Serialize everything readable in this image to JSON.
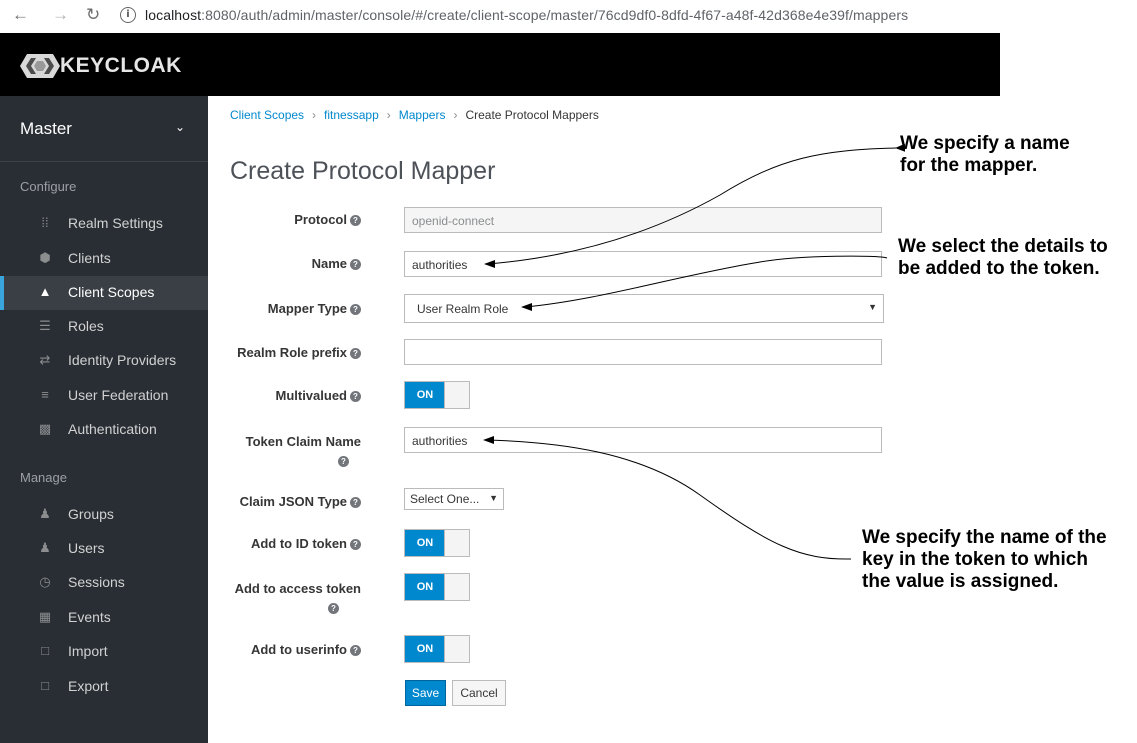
{
  "browser": {
    "url_host": "localhost",
    "url_rest": ":8080/auth/admin/master/console/#/create/client-scope/master/76cd9df0-8dfd-4f67-a48f-42d368e4e39f/mappers"
  },
  "header": {
    "logo_text": "KEYCLOAK"
  },
  "sidebar": {
    "realm": "Master",
    "configure_label": "Configure",
    "manage_label": "Manage",
    "configure_items": [
      {
        "label": "Realm Settings",
        "icon": "sliders-icon"
      },
      {
        "label": "Clients",
        "icon": "cube-icon"
      },
      {
        "label": "Client Scopes",
        "icon": "cubes-icon",
        "active": true
      },
      {
        "label": "Roles",
        "icon": "list-icon"
      },
      {
        "label": "Identity Providers",
        "icon": "exchange-icon"
      },
      {
        "label": "User Federation",
        "icon": "database-icon"
      },
      {
        "label": "Authentication",
        "icon": "lock-icon"
      }
    ],
    "manage_items": [
      {
        "label": "Groups",
        "icon": "users-icon"
      },
      {
        "label": "Users",
        "icon": "user-icon"
      },
      {
        "label": "Sessions",
        "icon": "clock-icon"
      },
      {
        "label": "Events",
        "icon": "calendar-icon"
      },
      {
        "label": "Import",
        "icon": "import-icon"
      },
      {
        "label": "Export",
        "icon": "export-icon"
      }
    ]
  },
  "breadcrumb": {
    "items": [
      "Client Scopes",
      "fitnessapp",
      "Mappers"
    ],
    "current": "Create Protocol Mappers"
  },
  "page_title": "Create Protocol Mapper",
  "form": {
    "protocol_label": "Protocol",
    "protocol_value": "openid-connect",
    "name_label": "Name",
    "name_value": "authorities",
    "mapper_type_label": "Mapper Type",
    "mapper_type_value": "User Realm Role",
    "realm_role_prefix_label": "Realm Role prefix",
    "realm_role_prefix_value": "",
    "multivalued_label": "Multivalued",
    "multivalued_state": "ON",
    "token_claim_name_label": "Token Claim Name",
    "token_claim_name_value": "authorities",
    "claim_json_type_label": "Claim JSON Type",
    "claim_json_type_value": "Select One...",
    "add_to_id_token_label": "Add to ID token",
    "add_to_id_token_state": "ON",
    "add_to_access_token_label": "Add to access token",
    "add_to_access_token_state": "ON",
    "add_to_userinfo_label": "Add to userinfo",
    "add_to_userinfo_state": "ON",
    "save_label": "Save",
    "cancel_label": "Cancel"
  },
  "annotations": {
    "name_line1": "We specify a name",
    "name_line2": "for the mapper.",
    "type_line1": "We select the details to",
    "type_line2": "be added to the token.",
    "claim_line1": "We specify the name of the",
    "claim_line2": "key in the token to which",
    "claim_line3": "the value is assigned."
  },
  "colors": {
    "accent": "#0088ce",
    "sidebar_bg": "#292e34",
    "header_bg": "#000000",
    "active_bar": "#39a5dc"
  }
}
